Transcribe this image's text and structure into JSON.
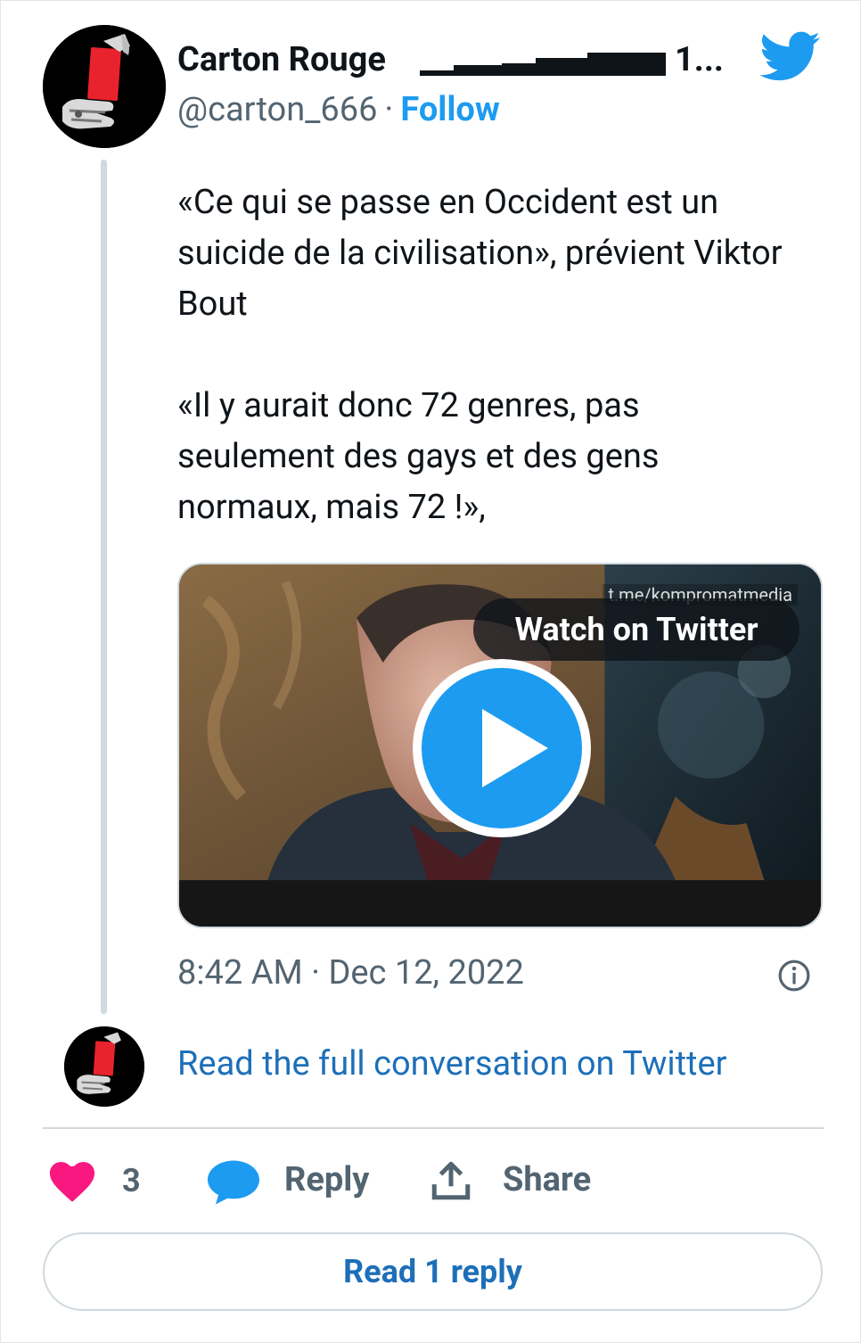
{
  "tweet": {
    "author": {
      "display_name": "Carton Rouge",
      "name_suffix": "1...",
      "handle": "@carton_666",
      "separator": "·",
      "follow_label": "Follow"
    },
    "text": "«Ce qui se passe en Occident est un suicide de la civilisation», prévient Viktor Bout\n\n«Il y aurait donc 72 genres, pas seulement des gays et des gens normaux, mais 72 !»,",
    "media": {
      "watermark": "t.me/kompromatmedia",
      "watch_label": "Watch on Twitter"
    },
    "timestamp": "8:42 AM · Dec 12, 2022",
    "read_conversation_label": "Read the full conversation on Twitter"
  },
  "actions": {
    "like_count": "3",
    "reply_label": "Reply",
    "share_label": "Share",
    "read_replies_label": "Read 1 reply"
  },
  "colors": {
    "brand_blue": "#1d9bf0",
    "link_blue": "#1d6fb8",
    "like_pink": "#f91880",
    "secondary_text": "#536471"
  },
  "icons": {
    "brand": "twitter-bird-icon",
    "info": "info-icon",
    "like": "heart-icon",
    "reply": "speech-bubble-icon",
    "share": "share-upload-icon",
    "play": "play-icon"
  }
}
